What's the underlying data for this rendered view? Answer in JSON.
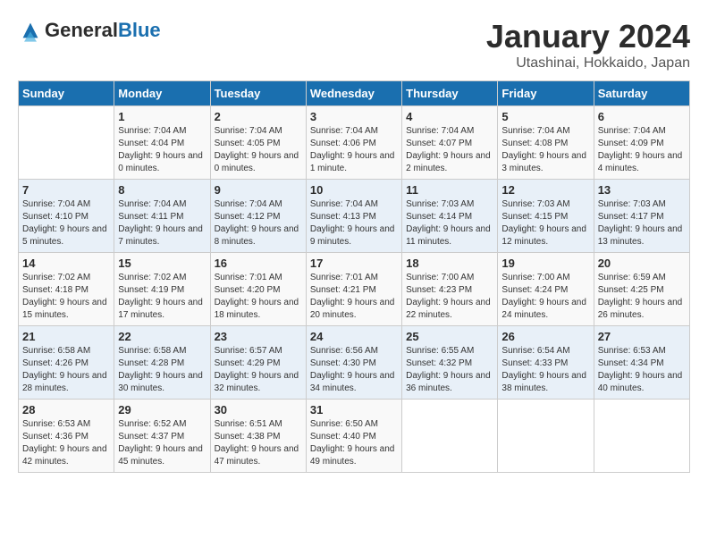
{
  "logo": {
    "text_general": "General",
    "text_blue": "Blue"
  },
  "header": {
    "month_year": "January 2024",
    "location": "Utashinai, Hokkaido, Japan"
  },
  "days_of_week": [
    "Sunday",
    "Monday",
    "Tuesday",
    "Wednesday",
    "Thursday",
    "Friday",
    "Saturday"
  ],
  "weeks": [
    [
      {
        "day": "",
        "sunrise": "",
        "sunset": "",
        "daylight": ""
      },
      {
        "day": "1",
        "sunrise": "Sunrise: 7:04 AM",
        "sunset": "Sunset: 4:04 PM",
        "daylight": "Daylight: 9 hours and 0 minutes."
      },
      {
        "day": "2",
        "sunrise": "Sunrise: 7:04 AM",
        "sunset": "Sunset: 4:05 PM",
        "daylight": "Daylight: 9 hours and 0 minutes."
      },
      {
        "day": "3",
        "sunrise": "Sunrise: 7:04 AM",
        "sunset": "Sunset: 4:06 PM",
        "daylight": "Daylight: 9 hours and 1 minute."
      },
      {
        "day": "4",
        "sunrise": "Sunrise: 7:04 AM",
        "sunset": "Sunset: 4:07 PM",
        "daylight": "Daylight: 9 hours and 2 minutes."
      },
      {
        "day": "5",
        "sunrise": "Sunrise: 7:04 AM",
        "sunset": "Sunset: 4:08 PM",
        "daylight": "Daylight: 9 hours and 3 minutes."
      },
      {
        "day": "6",
        "sunrise": "Sunrise: 7:04 AM",
        "sunset": "Sunset: 4:09 PM",
        "daylight": "Daylight: 9 hours and 4 minutes."
      }
    ],
    [
      {
        "day": "7",
        "sunrise": "Sunrise: 7:04 AM",
        "sunset": "Sunset: 4:10 PM",
        "daylight": "Daylight: 9 hours and 5 minutes."
      },
      {
        "day": "8",
        "sunrise": "Sunrise: 7:04 AM",
        "sunset": "Sunset: 4:11 PM",
        "daylight": "Daylight: 9 hours and 7 minutes."
      },
      {
        "day": "9",
        "sunrise": "Sunrise: 7:04 AM",
        "sunset": "Sunset: 4:12 PM",
        "daylight": "Daylight: 9 hours and 8 minutes."
      },
      {
        "day": "10",
        "sunrise": "Sunrise: 7:04 AM",
        "sunset": "Sunset: 4:13 PM",
        "daylight": "Daylight: 9 hours and 9 minutes."
      },
      {
        "day": "11",
        "sunrise": "Sunrise: 7:03 AM",
        "sunset": "Sunset: 4:14 PM",
        "daylight": "Daylight: 9 hours and 11 minutes."
      },
      {
        "day": "12",
        "sunrise": "Sunrise: 7:03 AM",
        "sunset": "Sunset: 4:15 PM",
        "daylight": "Daylight: 9 hours and 12 minutes."
      },
      {
        "day": "13",
        "sunrise": "Sunrise: 7:03 AM",
        "sunset": "Sunset: 4:17 PM",
        "daylight": "Daylight: 9 hours and 13 minutes."
      }
    ],
    [
      {
        "day": "14",
        "sunrise": "Sunrise: 7:02 AM",
        "sunset": "Sunset: 4:18 PM",
        "daylight": "Daylight: 9 hours and 15 minutes."
      },
      {
        "day": "15",
        "sunrise": "Sunrise: 7:02 AM",
        "sunset": "Sunset: 4:19 PM",
        "daylight": "Daylight: 9 hours and 17 minutes."
      },
      {
        "day": "16",
        "sunrise": "Sunrise: 7:01 AM",
        "sunset": "Sunset: 4:20 PM",
        "daylight": "Daylight: 9 hours and 18 minutes."
      },
      {
        "day": "17",
        "sunrise": "Sunrise: 7:01 AM",
        "sunset": "Sunset: 4:21 PM",
        "daylight": "Daylight: 9 hours and 20 minutes."
      },
      {
        "day": "18",
        "sunrise": "Sunrise: 7:00 AM",
        "sunset": "Sunset: 4:23 PM",
        "daylight": "Daylight: 9 hours and 22 minutes."
      },
      {
        "day": "19",
        "sunrise": "Sunrise: 7:00 AM",
        "sunset": "Sunset: 4:24 PM",
        "daylight": "Daylight: 9 hours and 24 minutes."
      },
      {
        "day": "20",
        "sunrise": "Sunrise: 6:59 AM",
        "sunset": "Sunset: 4:25 PM",
        "daylight": "Daylight: 9 hours and 26 minutes."
      }
    ],
    [
      {
        "day": "21",
        "sunrise": "Sunrise: 6:58 AM",
        "sunset": "Sunset: 4:26 PM",
        "daylight": "Daylight: 9 hours and 28 minutes."
      },
      {
        "day": "22",
        "sunrise": "Sunrise: 6:58 AM",
        "sunset": "Sunset: 4:28 PM",
        "daylight": "Daylight: 9 hours and 30 minutes."
      },
      {
        "day": "23",
        "sunrise": "Sunrise: 6:57 AM",
        "sunset": "Sunset: 4:29 PM",
        "daylight": "Daylight: 9 hours and 32 minutes."
      },
      {
        "day": "24",
        "sunrise": "Sunrise: 6:56 AM",
        "sunset": "Sunset: 4:30 PM",
        "daylight": "Daylight: 9 hours and 34 minutes."
      },
      {
        "day": "25",
        "sunrise": "Sunrise: 6:55 AM",
        "sunset": "Sunset: 4:32 PM",
        "daylight": "Daylight: 9 hours and 36 minutes."
      },
      {
        "day": "26",
        "sunrise": "Sunrise: 6:54 AM",
        "sunset": "Sunset: 4:33 PM",
        "daylight": "Daylight: 9 hours and 38 minutes."
      },
      {
        "day": "27",
        "sunrise": "Sunrise: 6:53 AM",
        "sunset": "Sunset: 4:34 PM",
        "daylight": "Daylight: 9 hours and 40 minutes."
      }
    ],
    [
      {
        "day": "28",
        "sunrise": "Sunrise: 6:53 AM",
        "sunset": "Sunset: 4:36 PM",
        "daylight": "Daylight: 9 hours and 42 minutes."
      },
      {
        "day": "29",
        "sunrise": "Sunrise: 6:52 AM",
        "sunset": "Sunset: 4:37 PM",
        "daylight": "Daylight: 9 hours and 45 minutes."
      },
      {
        "day": "30",
        "sunrise": "Sunrise: 6:51 AM",
        "sunset": "Sunset: 4:38 PM",
        "daylight": "Daylight: 9 hours and 47 minutes."
      },
      {
        "day": "31",
        "sunrise": "Sunrise: 6:50 AM",
        "sunset": "Sunset: 4:40 PM",
        "daylight": "Daylight: 9 hours and 49 minutes."
      },
      {
        "day": "",
        "sunrise": "",
        "sunset": "",
        "daylight": ""
      },
      {
        "day": "",
        "sunrise": "",
        "sunset": "",
        "daylight": ""
      },
      {
        "day": "",
        "sunrise": "",
        "sunset": "",
        "daylight": ""
      }
    ]
  ]
}
